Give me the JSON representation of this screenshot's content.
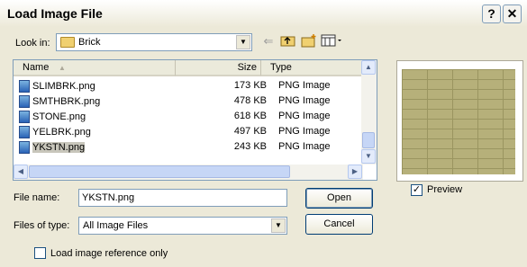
{
  "window": {
    "title": "Load Image File",
    "help_glyph": "?",
    "close_glyph": "✕"
  },
  "look_in": {
    "label": "Look in:",
    "value": "Brick"
  },
  "list": {
    "columns": {
      "name": "Name",
      "size": "Size",
      "type": "Type"
    },
    "rows": [
      {
        "name": "SLIMBRK.png",
        "size": "173 KB",
        "type": "PNG Image"
      },
      {
        "name": "SMTHBRK.png",
        "size": "478 KB",
        "type": "PNG Image"
      },
      {
        "name": "STONE.png",
        "size": "618 KB",
        "type": "PNG Image"
      },
      {
        "name": "YELBRK.png",
        "size": "497 KB",
        "type": "PNG Image"
      },
      {
        "name": "YKSTN.png",
        "size": "243 KB",
        "type": "PNG Image"
      }
    ],
    "selected_index": 4
  },
  "file_name": {
    "label": "File name:",
    "value": "YKSTN.png"
  },
  "file_type": {
    "label": "Files of type:",
    "value": "All Image Files"
  },
  "buttons": {
    "open": "Open",
    "cancel": "Cancel"
  },
  "preview": {
    "label": "Preview",
    "checked": true
  },
  "load_reference": {
    "label": "Load image reference only",
    "checked": false
  },
  "icons": {
    "back": "back-arrow-icon",
    "up": "up-folder-icon",
    "new_folder": "new-folder-icon",
    "view_menu": "view-menu-icon"
  }
}
